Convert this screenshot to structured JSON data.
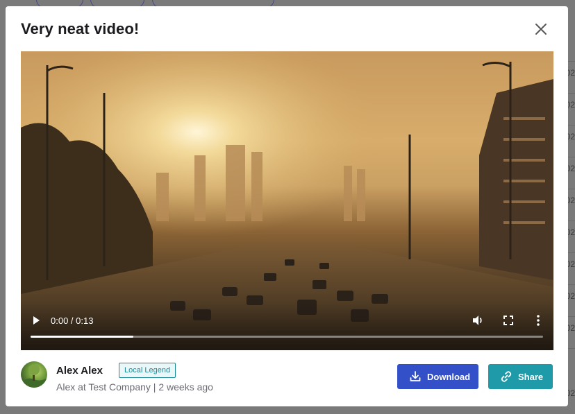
{
  "modal": {
    "title": "Very neat video!"
  },
  "video": {
    "time_display": "0:00 / 0:13",
    "progress": 0.2
  },
  "author": {
    "name": "Alex Alex",
    "badge": "Local Legend",
    "meta": "Alex at Test Company | 2 weeks ago"
  },
  "actions": {
    "download_label": "Download",
    "share_label": "Share"
  },
  "background": {
    "cells": [
      "02",
      "02",
      "02",
      "02",
      "02",
      "02",
      "02",
      "02",
      "02",
      "02"
    ]
  },
  "colors": {
    "download": "#3350c9",
    "share": "#1f9aa8",
    "badge": "#1a8b9a"
  },
  "icons": [
    "close-icon",
    "play-icon",
    "volume-icon",
    "fullscreen-icon",
    "more-vertical-icon",
    "download-icon",
    "link-icon"
  ]
}
